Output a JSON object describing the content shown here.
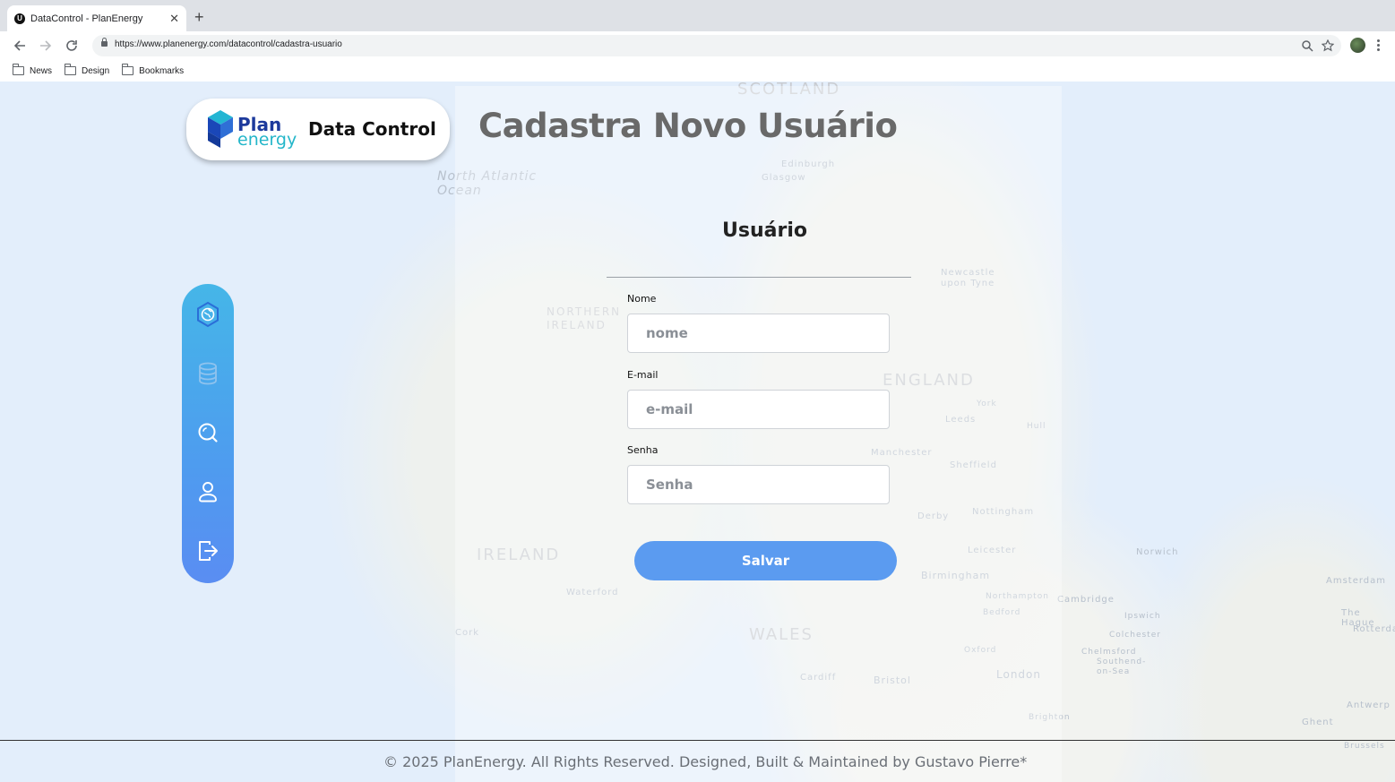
{
  "browser": {
    "tab_title": "DataControl - PlanEnergy",
    "tab_favicon_letter": "U",
    "url": "https://www.planenergy.com/datacontrol/cadastra-usuario",
    "bookmarks": [
      {
        "label": "News"
      },
      {
        "label": "Design"
      },
      {
        "label": "Bookmarks"
      }
    ]
  },
  "logo": {
    "plan": "Plan",
    "energy": "energy",
    "app_name": "Data Control"
  },
  "page": {
    "title": "Cadastra Novo Usuário"
  },
  "sidebar": {
    "items": [
      {
        "icon": "hexagon-globe-icon",
        "active": true
      },
      {
        "icon": "database-icon",
        "active": false
      },
      {
        "icon": "search-icon",
        "active": false
      },
      {
        "icon": "user-icon",
        "active": false
      },
      {
        "icon": "logout-icon",
        "active": false
      }
    ]
  },
  "form": {
    "title": "Usuário",
    "name_label": "Nome",
    "name_placeholder": "nome",
    "email_label": "E-mail",
    "email_placeholder": "e-mail",
    "password_label": "Senha",
    "password_placeholder": "Senha",
    "save_label": "Salvar"
  },
  "map_labels": [
    "SCOTLAND",
    "North Atlantic Ocean",
    "NORTHERN IRELAND",
    "ENGLAND",
    "IRELAND",
    "WALES",
    "Edinburgh",
    "Glasgow",
    "Newcastle upon Tyne",
    "Leeds",
    "Manchester",
    "Sheffield",
    "Birmingham",
    "London",
    "Cambridge",
    "Norwich",
    "Cork",
    "Waterford",
    "Bristol",
    "Cardiff",
    "Amsterdam",
    "The Hague",
    "Rotterdam",
    "Antwerp",
    "Ghent",
    "Brussels",
    "Hull",
    "York",
    "Nottingham",
    "Leicester",
    "Oxford",
    "Ipswich",
    "Colchester",
    "Chelmsford",
    "Southend-on-Sea",
    "Brighton",
    "Derby",
    "Northampton",
    "Bedford"
  ],
  "footer": {
    "text": "© 2025 PlanEnergy. All Rights Reserved. Designed, Built & Maintained by Gustavo Pierre*"
  },
  "colors": {
    "sidebar_gradient_top": "#45b6e8",
    "sidebar_gradient_bottom": "#5a8df2",
    "save_button": "#5b9bf0",
    "title_gray": "#696969",
    "logo_blue": "#1d3a9c",
    "logo_cyan": "#24b6c9"
  }
}
